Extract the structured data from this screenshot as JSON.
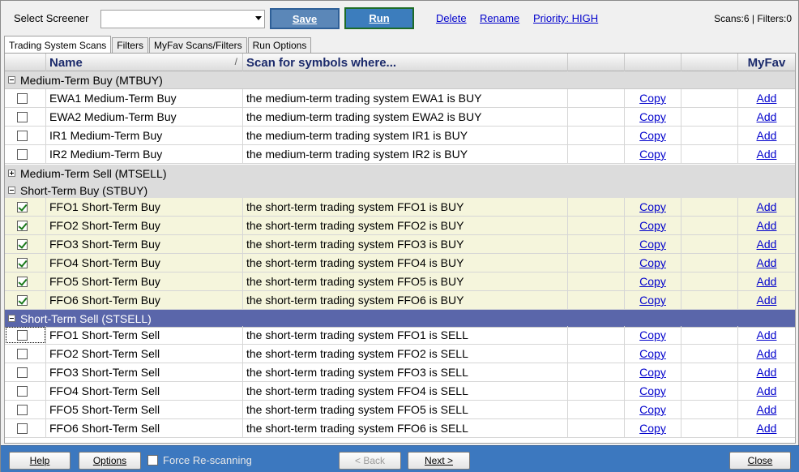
{
  "topbar": {
    "select_label": "Select Screener",
    "combo_value": "",
    "save_label": "Save",
    "run_label": "Run",
    "delete_label": "Delete",
    "rename_label": "Rename",
    "priority_label": "Priority: HIGH",
    "counts": "Scans:6 | Filters:0"
  },
  "tabs": [
    "Trading System Scans",
    "Filters",
    "MyFav Scans/Filters",
    "Run Options"
  ],
  "columns": {
    "name": "Name",
    "sort_mark": "/",
    "scan": "Scan for symbols where...",
    "col4": "",
    "col5": "",
    "col6": "",
    "myfav": "MyFav"
  },
  "groups": {
    "mtbuy": "Medium-Term Buy (MTBUY)",
    "mtsell": "Medium-Term Sell (MTSELL)",
    "stbuy": "Short-Term Buy (STBUY)",
    "stsell": "Short-Term Sell (STSELL)"
  },
  "mtbuy_rows": [
    {
      "name": "EWA1 Medium-Term Buy",
      "scan": "the medium-term trading system EWA1 is BUY",
      "copy": "Copy",
      "add": "Add"
    },
    {
      "name": "EWA2 Medium-Term Buy",
      "scan": "the medium-term trading system EWA2 is BUY",
      "copy": "Copy",
      "add": "Add"
    },
    {
      "name": "IR1 Medium-Term Buy",
      "scan": "the medium-term trading system IR1 is BUY",
      "copy": "Copy",
      "add": "Add"
    },
    {
      "name": "IR2 Medium-Term Buy",
      "scan": "the medium-term trading system IR2 is BUY",
      "copy": "Copy",
      "add": "Add"
    }
  ],
  "stbuy_rows": [
    {
      "name": "FFO1 Short-Term Buy",
      "scan": "the short-term trading system FFO1 is BUY",
      "copy": "Copy",
      "add": "Add"
    },
    {
      "name": "FFO2 Short-Term Buy",
      "scan": "the short-term trading system FFO2 is BUY",
      "copy": "Copy",
      "add": "Add"
    },
    {
      "name": "FFO3 Short-Term Buy",
      "scan": "the short-term trading system FFO3 is BUY",
      "copy": "Copy",
      "add": "Add"
    },
    {
      "name": "FFO4 Short-Term Buy",
      "scan": "the short-term trading system FFO4 is BUY",
      "copy": "Copy",
      "add": "Add"
    },
    {
      "name": "FFO5 Short-Term Buy",
      "scan": "the short-term trading system FFO5 is BUY",
      "copy": "Copy",
      "add": "Add"
    },
    {
      "name": "FFO6 Short-Term Buy",
      "scan": "the short-term trading system FFO6 is BUY",
      "copy": "Copy",
      "add": "Add"
    }
  ],
  "stsell_rows": [
    {
      "name": "FFO1 Short-Term Sell",
      "scan": "the short-term trading system FFO1 is SELL",
      "copy": "Copy",
      "add": "Add"
    },
    {
      "name": "FFO2 Short-Term Sell",
      "scan": "the short-term trading system FFO2 is SELL",
      "copy": "Copy",
      "add": "Add"
    },
    {
      "name": "FFO3 Short-Term Sell",
      "scan": "the short-term trading system FFO3 is SELL",
      "copy": "Copy",
      "add": "Add"
    },
    {
      "name": "FFO4 Short-Term Sell",
      "scan": "the short-term trading system FFO4 is SELL",
      "copy": "Copy",
      "add": "Add"
    },
    {
      "name": "FFO5 Short-Term Sell",
      "scan": "the short-term trading system FFO5 is SELL",
      "copy": "Copy",
      "add": "Add"
    },
    {
      "name": "FFO6 Short-Term Sell",
      "scan": "the short-term trading system FFO6 is SELL",
      "copy": "Copy",
      "add": "Add"
    }
  ],
  "bottombar": {
    "help": "Help",
    "options": "Options",
    "force_rescan": "Force Re-scanning",
    "back": "< Back",
    "next": "Next >",
    "close": "Close"
  }
}
